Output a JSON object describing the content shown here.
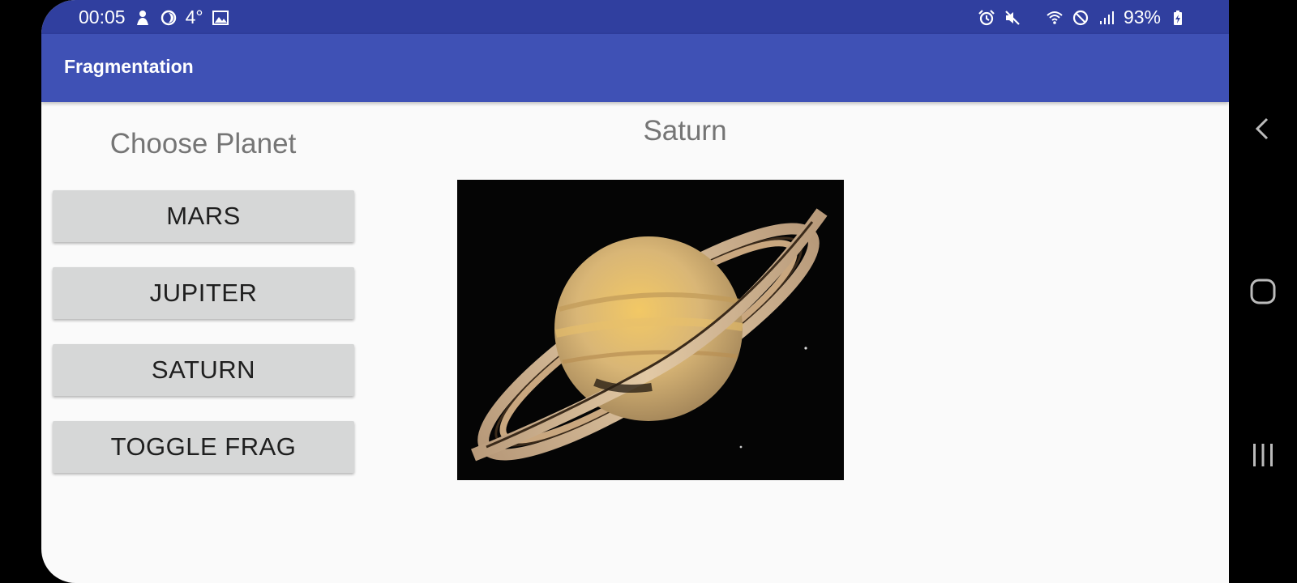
{
  "status_bar": {
    "time": "00:05",
    "temperature": "4°",
    "battery": "93%",
    "left_icons": [
      "notification-icon",
      "moon-icon",
      "image-icon"
    ],
    "right_icons": [
      "alarm-icon",
      "mute-icon",
      "wifi-icon",
      "do-not-disturb-icon",
      "signal-icon",
      "battery-charging-icon"
    ]
  },
  "app_bar": {
    "title": "Fragmentation"
  },
  "left_panel": {
    "heading": "Choose Planet",
    "buttons": [
      {
        "label": "MARS"
      },
      {
        "label": "JUPITER"
      },
      {
        "label": "SATURN"
      },
      {
        "label": "TOGGLE FRAG"
      }
    ]
  },
  "detail": {
    "planet_name": "Saturn",
    "image_icon": "saturn-image"
  },
  "nav_bar": {
    "icons": [
      "back-icon",
      "home-icon",
      "recent-apps-icon"
    ]
  },
  "colors": {
    "status_bar": "#303f9f",
    "app_bar": "#3f51b5",
    "background": "#fafafa",
    "button": "#d6d7d7",
    "text_secondary": "#757575"
  }
}
